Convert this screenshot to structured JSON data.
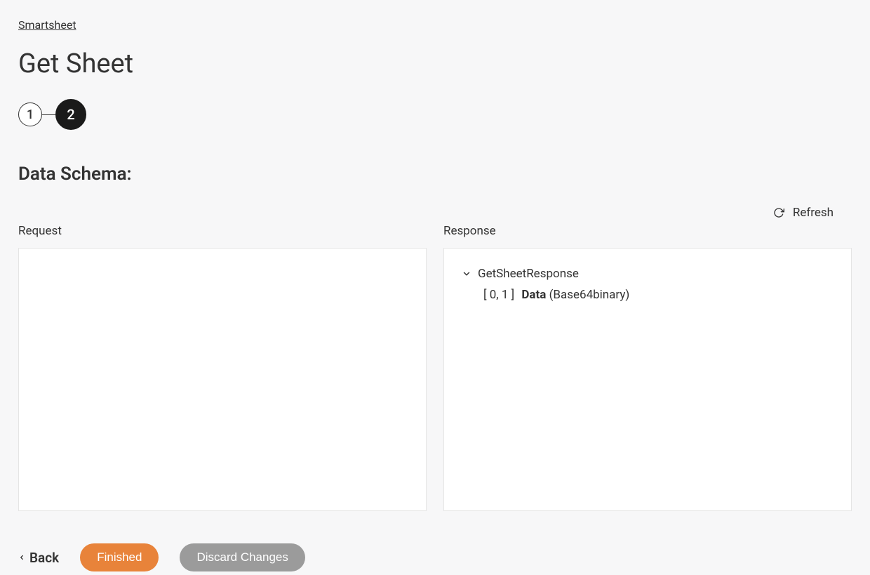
{
  "breadcrumb": {
    "label": "Smartsheet"
  },
  "page": {
    "title": "Get Sheet",
    "section_title": "Data Schema:"
  },
  "stepper": {
    "step1": "1",
    "step2": "2"
  },
  "refresh": {
    "label": "Refresh"
  },
  "panels": {
    "request_label": "Request",
    "response_label": "Response"
  },
  "response_tree": {
    "root": "GetSheetResponse",
    "child": {
      "cardinality": "[ 0, 1 ]",
      "name": "Data",
      "type": "(Base64binary)"
    }
  },
  "actions": {
    "back": "Back",
    "finished": "Finished",
    "discard": "Discard Changes"
  }
}
